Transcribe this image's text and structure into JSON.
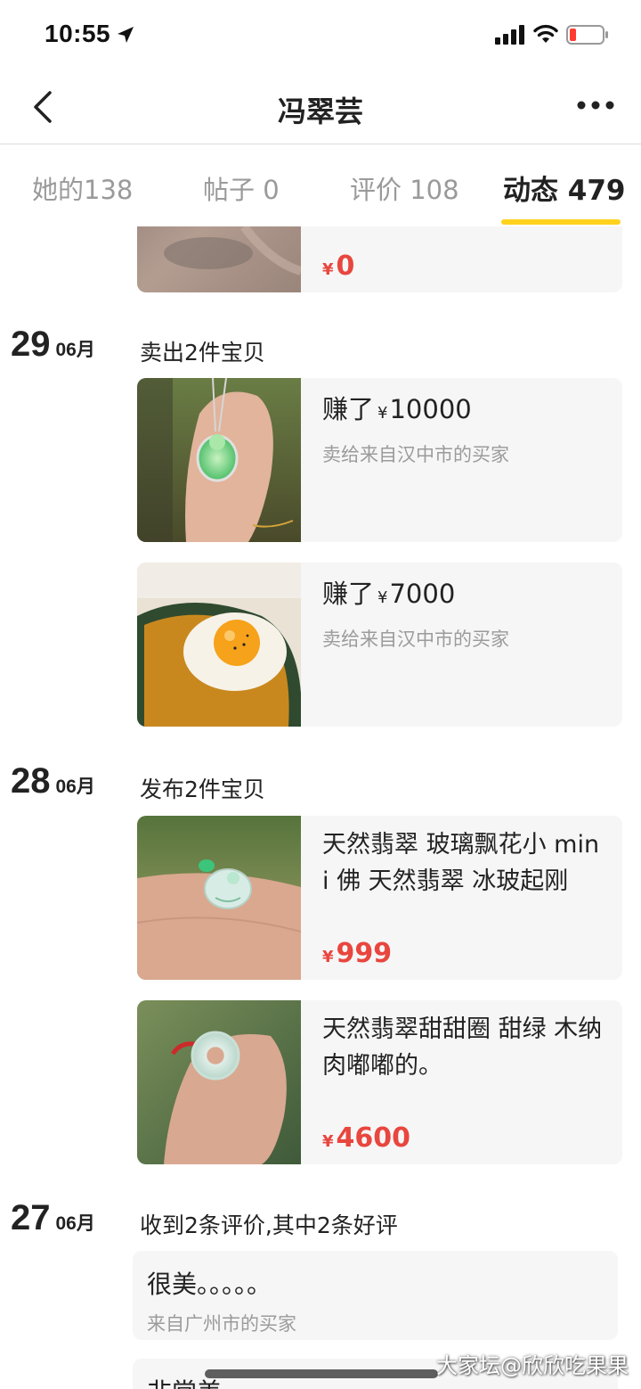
{
  "status_bar": {
    "time": "10:55"
  },
  "nav": {
    "title": "冯翠芸"
  },
  "tabs": [
    {
      "label": "她的138"
    },
    {
      "label": "帖子 0"
    },
    {
      "label": "评价 108"
    },
    {
      "label": "动态 479"
    }
  ],
  "colors": {
    "accent": "#ffd21f",
    "price": "#e8463e"
  },
  "feed": {
    "top_card": {
      "price_symbol": "¥",
      "price": "0"
    },
    "groups": [
      {
        "day": "29",
        "month": "06月",
        "caption": "卖出2件宝贝",
        "items": [
          {
            "earn_prefix": "赚了",
            "currency": "¥",
            "amount": "10000",
            "buyer": "卖给来自汉中市的买家",
            "thumb_icon": "jade-pendant-photo"
          },
          {
            "earn_prefix": "赚了",
            "currency": "¥",
            "amount": "7000",
            "buyer": "卖给来自汉中市的买家",
            "thumb_icon": "pumpkin-egg-photo"
          }
        ]
      },
      {
        "day": "28",
        "month": "06月",
        "caption": "发布2件宝贝",
        "items": [
          {
            "title": "天然翡翠 玻璃飘花小 mini 佛 天然翡翠 冰玻起刚",
            "currency": "¥",
            "price": "999",
            "thumb_icon": "jade-buddha-photo"
          },
          {
            "title": "天然翡翠甜甜圈 甜绿 木纳肉嘟嘟的。",
            "currency": "¥",
            "price": "4600",
            "thumb_icon": "jade-ring-photo"
          }
        ]
      },
      {
        "day": "27",
        "month": "06月",
        "caption": "收到2条评价,其中2条好评",
        "reviews": [
          {
            "text": "很美。。。。。",
            "from": "来自广州市的买家"
          },
          {
            "text": "非常美"
          }
        ]
      }
    ]
  },
  "watermark": "大家坛@欣欣吃果果"
}
